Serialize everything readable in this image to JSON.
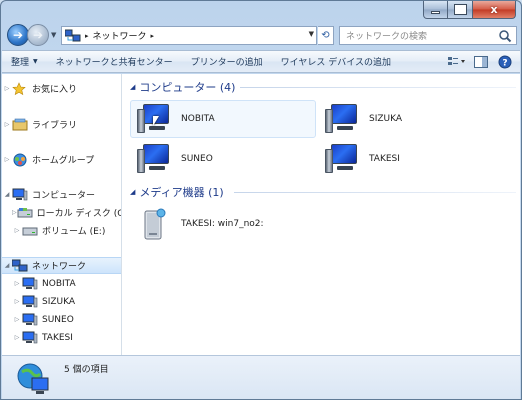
{
  "window": {
    "caption_min": "",
    "caption_max": "",
    "caption_close": "x"
  },
  "address": {
    "path_sep": "▸",
    "location": "ネットワーク",
    "trailing_sep": "▸",
    "search_placeholder": "ネットワークの検索"
  },
  "toolbar": {
    "organize": "整理",
    "network_center": "ネットワークと共有センター",
    "add_printer": "プリンターの追加",
    "add_wireless": "ワイヤレス デバイスの追加"
  },
  "sidebar": {
    "items": [
      {
        "label": "お気に入り",
        "icon": "star-icon"
      },
      {
        "label": "ライブラリ",
        "icon": "library-icon"
      },
      {
        "label": "ホームグループ",
        "icon": "homegroup-icon"
      },
      {
        "label": "コンピューター",
        "icon": "computer-icon"
      },
      {
        "label": "ローカル ディスク (C:)",
        "icon": "disk-icon"
      },
      {
        "label": "ボリューム (E:)",
        "icon": "volume-icon"
      },
      {
        "label": "ネットワーク",
        "icon": "network-icon"
      },
      {
        "label": "NOBITA",
        "icon": "computer-icon"
      },
      {
        "label": "SIZUKA",
        "icon": "computer-icon"
      },
      {
        "label": "SUNEO",
        "icon": "computer-icon"
      },
      {
        "label": "TAKESI",
        "icon": "computer-icon"
      }
    ]
  },
  "content": {
    "computers_header": "コンピューター (4)",
    "computers": [
      "NOBITA",
      "SIZUKA",
      "SUNEO",
      "TAKESI"
    ],
    "media_header": "メディア機器 (1)",
    "media": [
      "TAKESI: win7_no2:"
    ]
  },
  "status": {
    "text": "5 個の項目"
  },
  "colors": {
    "accent": "#1e3b8a",
    "selection": "#cde4fb",
    "chrome": "#c8dcf1"
  }
}
